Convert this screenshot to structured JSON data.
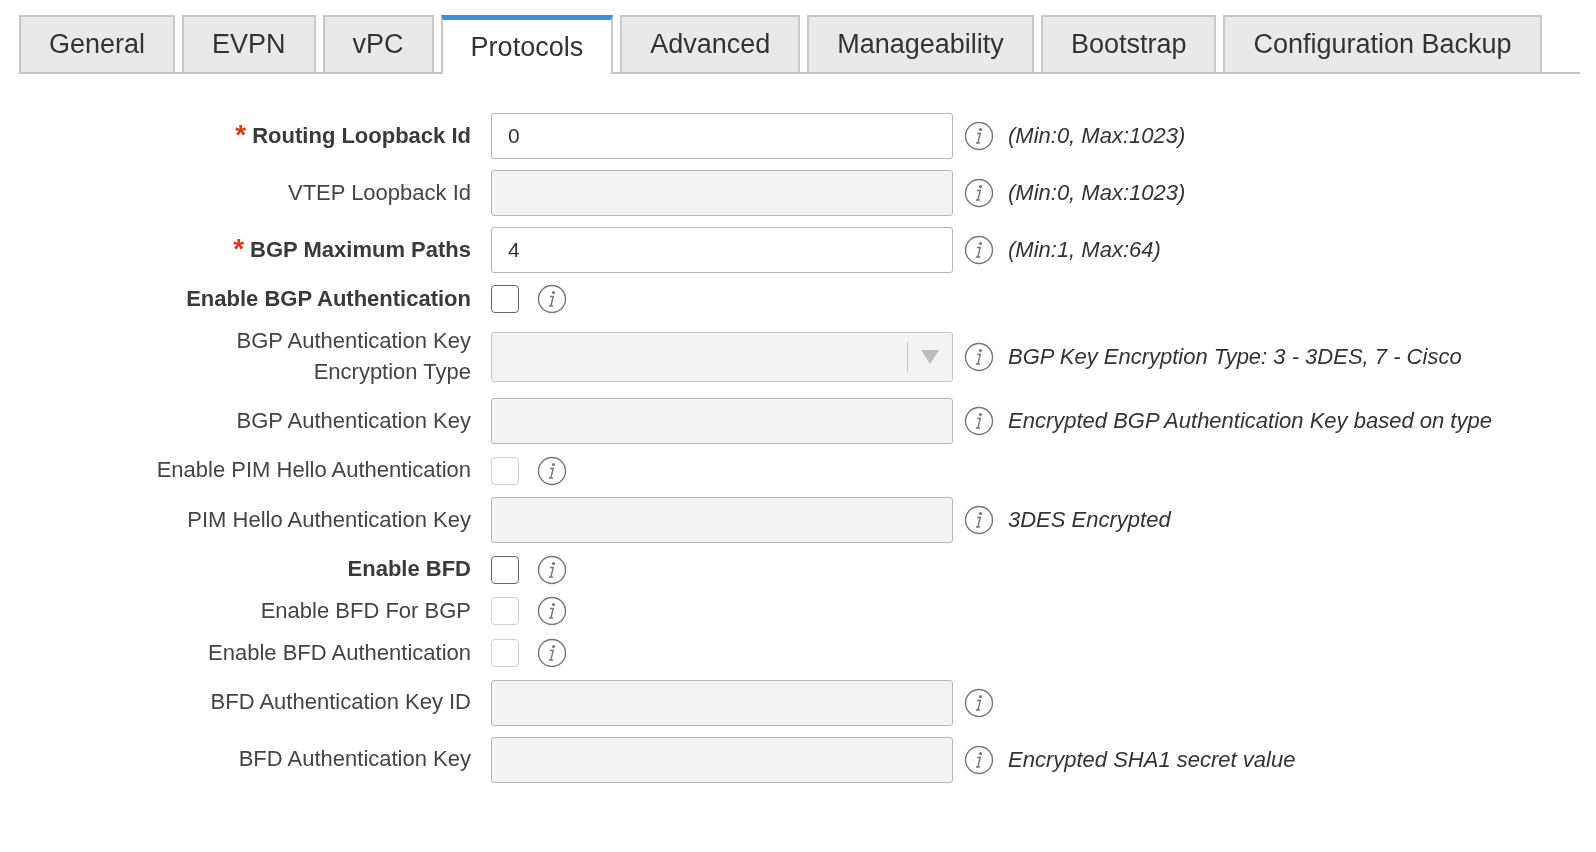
{
  "tabs": [
    {
      "label": "General",
      "selected": false
    },
    {
      "label": "EVPN",
      "selected": false
    },
    {
      "label": "vPC",
      "selected": false
    },
    {
      "label": "Protocols",
      "selected": true
    },
    {
      "label": "Advanced",
      "selected": false
    },
    {
      "label": "Manageability",
      "selected": false
    },
    {
      "label": "Bootstrap",
      "selected": false
    },
    {
      "label": "Configuration Backup",
      "selected": false
    }
  ],
  "fields": [
    {
      "kind": "text",
      "required_mark": "*",
      "label": "Routing Loopback Id",
      "value": "0",
      "disabled": false,
      "hint": "(Min:0, Max:1023)"
    },
    {
      "kind": "text",
      "label": "VTEP Loopback Id",
      "disabled": true,
      "hint": "(Min:0, Max:1023)"
    },
    {
      "kind": "text",
      "required_mark": "*",
      "label": "BGP Maximum Paths",
      "value": "4",
      "disabled": false,
      "hint": "(Min:1, Max:64)"
    },
    {
      "kind": "checkbox",
      "label": "Enable BGP Authentication",
      "disabled": false,
      "checked": false
    },
    {
      "kind": "select",
      "label": "BGP Authentication Key Encryption Type",
      "disabled": true,
      "hint": "BGP Key Encryption Type: 3 - 3DES, 7 - Cisco"
    },
    {
      "kind": "text",
      "label": "BGP Authentication Key",
      "disabled": true,
      "hint": "Encrypted BGP Authentication Key based on type"
    },
    {
      "kind": "checkbox",
      "label": "Enable PIM Hello Authentication",
      "disabled": true,
      "checked": false
    },
    {
      "kind": "text",
      "label": "PIM Hello Authentication Key",
      "disabled": true,
      "hint": "3DES Encrypted"
    },
    {
      "kind": "checkbox",
      "label": "Enable BFD",
      "disabled": false,
      "checked": false
    },
    {
      "kind": "checkbox",
      "label": "Enable BFD For BGP",
      "disabled": true,
      "checked": false
    },
    {
      "kind": "checkbox",
      "label": "Enable BFD Authentication",
      "disabled": true,
      "checked": false
    },
    {
      "kind": "text",
      "label": "BFD Authentication Key ID",
      "disabled": true
    },
    {
      "kind": "text",
      "label": "BFD Authentication Key",
      "disabled": true,
      "hint": "Encrypted SHA1 secret value"
    }
  ]
}
